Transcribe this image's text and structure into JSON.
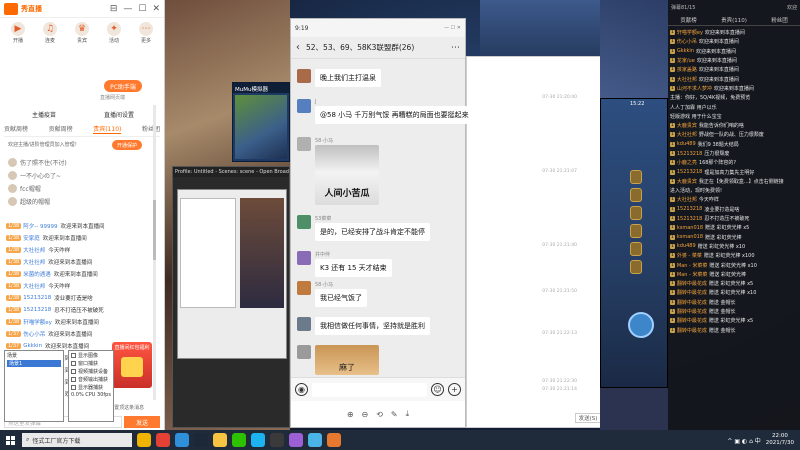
{
  "left_app": {
    "brand": "秀直播",
    "window_controls": [
      "⊟",
      "—",
      "☐",
      "✕"
    ],
    "toolbar": [
      {
        "label": "开播",
        "icon": "play-icon"
      },
      {
        "label": "连麦",
        "icon": "mic-icon"
      },
      {
        "label": "贵宾",
        "icon": "vip-icon"
      },
      {
        "label": "活动",
        "icon": "gift-icon"
      },
      {
        "label": "更多",
        "icon": "more-icon"
      }
    ],
    "pc_badge": "PC助手端",
    "pc_badge_sub": "直播网页端",
    "subtabs": [
      "主播疫苗",
      "直播间设置"
    ],
    "tabs": [
      "贡献周榜",
      "贡献周榜",
      "贵宾(110)",
      "粉丝团"
    ],
    "active_tab_index": 2,
    "open_guard_button": "开通保护",
    "notice": "欢迎主播/进阶管理员加入管理！",
    "gifts": [
      "伤了照不住(不讨)",
      "一不小心の了~",
      "fcc帽帽",
      "超级的帽帽"
    ],
    "chat": [
      {
        "lv": "1/38",
        "name": "阿夕-- 99999",
        "text": "欢迎来到本直播间"
      },
      {
        "lv": "1/38",
        "name": "安家庭",
        "text": "欢迎来到本直播间"
      },
      {
        "lv": "1/38",
        "name": "大社社邦",
        "text": "今天咋样"
      },
      {
        "lv": "1/38",
        "name": "大社社邦",
        "text": "欢迎来到本直播间"
      },
      {
        "lv": "1/38",
        "name": "米菌的遇遇",
        "text": "欢迎来到本直播间"
      },
      {
        "lv": "1/38",
        "name": "大社社邦",
        "text": "今天咋样"
      },
      {
        "lv": "1/38",
        "name": "15213218",
        "text": "凌业要打造是啥"
      },
      {
        "lv": "1/38",
        "name": "15213218",
        "text": "忍不打造压不被破死"
      },
      {
        "lv": "1/38",
        "name": "轩喵学额ey",
        "text": "欢迎来到本直播间"
      },
      {
        "lv": "1/37",
        "name": "伤心小吊",
        "text": "欢迎来到本直播间"
      },
      {
        "lv": "1/37",
        "name": "Gkkkin",
        "text": "欢迎来到本直播间"
      },
      {
        "lv": "1/36",
        "name": "伤死/.ue",
        "text": "欢迎来到本直播间"
      },
      {
        "lv": "1/35",
        "name": "孩家盖路",
        "text": "欢迎来到本直播间"
      },
      {
        "lv": "1/35",
        "name": "大社社邦",
        "text": "欢迎来到本直播间"
      },
      {
        "lv": "1/35",
        "name": "山河不求人梦冲",
        "text": "欢迎来到本直播间"
      }
    ],
    "promo_title": "直播间红包福利",
    "pin_check": "置顶这条消息",
    "input_placeholder": "点这里发弹幕",
    "send_label": "发送"
  },
  "emulator": {
    "title": "MuMu模拟器"
  },
  "obs": {
    "title": "Profile: Untitled - Scenes: scene - Open Broadcaster",
    "scenes_label": "场景",
    "scene_item": "场景1",
    "sources": [
      "显示图像",
      "窗口捕获",
      "视频捕获设备",
      "音频输出捕获",
      "显示器捕获"
    ],
    "status": "0.0% CPU 30fps"
  },
  "wechat": {
    "window_title": "52、53、69、58K3联盟群(26)",
    "window_status": "9:19",
    "title": "52、53、69、58K3联盟群(26)",
    "messages": [
      {
        "name": "",
        "text": "晚上我们主打温泉",
        "type": "text"
      },
      {
        "name": "J",
        "text": "@58 小马  千万别气馁 再糟糕的局面也要挺起来",
        "type": "text"
      },
      {
        "name": "58·小马",
        "text": "人间小苦瓜",
        "type": "sticker-dog"
      },
      {
        "name": "53菜菜",
        "text": "是的，已经安排了战斗肯定不能停",
        "type": "text"
      },
      {
        "name": "并中伴",
        "text": "K3 还有 15 天才结束",
        "type": "text"
      },
      {
        "name": "58·小马",
        "text": "我已经气饭了",
        "type": "text"
      },
      {
        "name": "",
        "text": "我相信做任何事情，坚持就是胜利",
        "type": "text"
      },
      {
        "name": "",
        "text": "麻了",
        "type": "sticker-shiba"
      }
    ],
    "viewer_tools": [
      "⊕",
      "⊖",
      "⟲",
      "✎",
      "⤓"
    ]
  },
  "blank_window": {
    "timestamps": [
      "07-30 21:20:40",
      "07-30 21:21:07",
      "07-30 21:21:40",
      "07-30 21:21:50",
      "07-30 21:22:13",
      "07-30 21:22:30",
      "07-30 21:21:14"
    ],
    "send_label": "发送(S)"
  },
  "game_window": {
    "time": "15:22"
  },
  "danmaku": {
    "top_left": "弹幕81/15",
    "top_right": "欢迎",
    "tabs": [
      "贡献榜",
      "贵宾(110)",
      "粉丝团"
    ],
    "rows": [
      {
        "lv": "1",
        "name": "轩喵学额ey",
        "text": "欢迎来到本直播间"
      },
      {
        "lv": "1",
        "name": "伤心小吊",
        "text": "欢迎来到本直播间"
      },
      {
        "lv": "1",
        "name": "Gkkkin",
        "text": "欢迎来到本直播间"
      },
      {
        "lv": "1",
        "name": "龙家/ue",
        "text": "欢迎来到本直播间"
      },
      {
        "lv": "1",
        "name": "孩家盖路",
        "text": "欢迎来到本直播间"
      },
      {
        "lv": "1",
        "name": "大社社邦",
        "text": "欢迎来到本直播间"
      },
      {
        "lv": "1",
        "name": "山河不求人梦冲",
        "text": "欢迎来到本直播间"
      },
      {
        "lv": "",
        "name": "",
        "text": "主播：你好，5Q/4K视频，免费预览"
      },
      {
        "lv": "",
        "name": "",
        "text": "人人丁加霖 用户以乐"
      },
      {
        "lv": "",
        "name": "",
        "text": "轻版游戏 用于什么宝宝"
      },
      {
        "lv": "1",
        "name": "大鹿贵宾",
        "text": "我能告诉你们咱的啥"
      },
      {
        "lv": "1",
        "name": "大社社邦",
        "text": "野战但一队的战、压力很颓废"
      },
      {
        "lv": "1",
        "name": "kdu489",
        "text": "我们9 38题大结局"
      },
      {
        "lv": "1",
        "name": "15213218",
        "text": "压力很颓废"
      },
      {
        "lv": "1",
        "name": "小鹿之亮",
        "text": "168那个阵容的?"
      },
      {
        "lv": "1",
        "name": "15213218",
        "text": "理是加高力集先主明好"
      },
      {
        "lv": "1",
        "name": "大鹿贵宾",
        "text": "我正在【免费领取盒...】点击右侧链接"
      },
      {
        "lv": "",
        "name": "",
        "text": "进入活动，现时免费领!"
      },
      {
        "lv": "1",
        "name": "大社社邦",
        "text": "今天咋样"
      },
      {
        "lv": "1",
        "name": "15213218",
        "text": "凌业要打造是啥"
      },
      {
        "lv": "1",
        "name": "15213218",
        "text": "忍不打造压不被破死"
      },
      {
        "lv": "1",
        "name": "ksman018",
        "text": "赠送 彩虹荧光棒 x5"
      },
      {
        "lv": "1",
        "name": "ksman018",
        "text": "赠送 彩虹荧光棒"
      },
      {
        "lv": "1",
        "name": "kdu489",
        "text": "赠送 彩虹荧光棒 x10"
      },
      {
        "lv": "1",
        "name": "外婆 - 菜菜",
        "text": "赠送 彩虹荧光棒 x100"
      },
      {
        "lv": "1",
        "name": "Man - 米菜菜",
        "text": "赠送 彩虹荧光棒 x10"
      },
      {
        "lv": "1",
        "name": "Man - 米菜菜",
        "text": "赠送 彩虹荧光棒"
      },
      {
        "lv": "1",
        "name": "翻转中最花成",
        "text": "赠送 彩虹荧光棒 x5"
      },
      {
        "lv": "1",
        "name": "翻转中最花成",
        "text": "赠送 彩虹荧光棒 x10"
      },
      {
        "lv": "1",
        "name": "翻转中最花成",
        "text": "赠送 金帽长"
      },
      {
        "lv": "1",
        "name": "翻转中最花成",
        "text": "赠送 金帽长"
      },
      {
        "lv": "1",
        "name": "翻转中最花成",
        "text": "赠送 彩虹荧光棒 x5"
      },
      {
        "lv": "1",
        "name": "翻转中最花成",
        "text": "赠送 金帽长"
      }
    ]
  },
  "taskbar": {
    "search_text": "怪式工厂官方下载",
    "apps": [
      {
        "icon": "cortana-icon",
        "color": "#f0b400"
      },
      {
        "icon": "chrome-icon",
        "color": "#e34133"
      },
      {
        "icon": "edge-icon",
        "color": "#2f8fd8"
      },
      {
        "icon": "steam-icon",
        "color": "#1b2838"
      },
      {
        "icon": "file-explorer-icon",
        "color": "#f6c343"
      },
      {
        "icon": "wechat-icon",
        "color": "#2dc100"
      },
      {
        "icon": "qq-icon",
        "color": "#1cb3f0"
      },
      {
        "icon": "obs-icon",
        "color": "#3a3a3a"
      },
      {
        "icon": "game-icon",
        "color": "#9c5fd6"
      },
      {
        "icon": "mumu-icon",
        "color": "#4bb4e6"
      },
      {
        "icon": "app-icon",
        "color": "#e57a2f"
      }
    ],
    "tray": "^ ▣ ◐ ⌂ 中",
    "clock_time": "22:00",
    "clock_date": "2021/7/30"
  }
}
